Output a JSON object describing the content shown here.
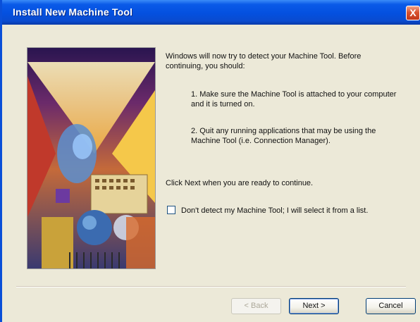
{
  "window": {
    "title": "Install New Machine Tool",
    "close_glyph": "X"
  },
  "instructions": {
    "intro": "Windows will  now try to detect your Machine Tool.  Before continuing, you should:",
    "step1": "1. Make sure the Machine Tool is attached to your computer and it is turned on.",
    "step2": "2. Quit any running applications that may be using the Machine Tool (i.e. Connection Manager).",
    "next_prompt": "Click Next when you are ready to continue."
  },
  "checkbox": {
    "label": "Don't detect my Machine Tool; I will select it from a list.",
    "checked": false
  },
  "buttons": {
    "back": "< Back",
    "next": "Next >",
    "cancel": "Cancel",
    "back_enabled": false
  },
  "colors": {
    "titlebar": "#0450df",
    "dialog_bg": "#ece9d8",
    "close": "#d9532f"
  }
}
